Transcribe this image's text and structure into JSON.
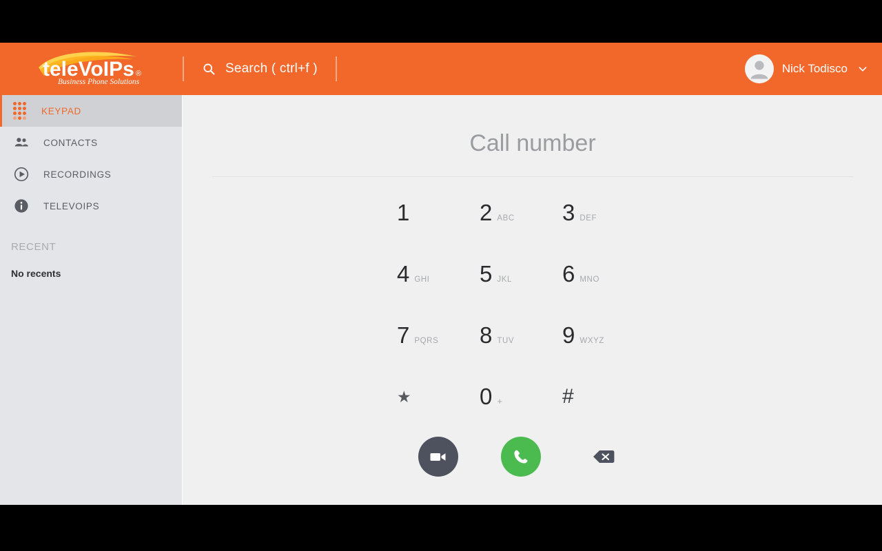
{
  "brand": {
    "logo_text": "teleVoIPs",
    "logo_registered": "®",
    "logo_tagline": "Business Phone Solutions",
    "accent_color": "#f2672a",
    "call_green": "#4cbb4f",
    "video_gray": "#4d525e"
  },
  "topbar": {
    "search_icon": "search-icon",
    "search_label": "Search ( ctrl+f )",
    "user_name": "Nick Todisco",
    "avatar_icon": "user-avatar-icon",
    "chevron_icon": "chevron-down-icon"
  },
  "sidebar": {
    "items": [
      {
        "label": "KEYPAD",
        "icon": "keypad-dots-icon",
        "active": true
      },
      {
        "label": "CONTACTS",
        "icon": "people-icon",
        "active": false
      },
      {
        "label": "RECORDINGS",
        "icon": "play-circle-icon",
        "active": false
      },
      {
        "label": "TELEVOIPS",
        "icon": "info-icon",
        "active": false
      }
    ],
    "recent_heading": "RECENT",
    "no_recents": "No recents"
  },
  "dialer": {
    "number_placeholder": "Call number",
    "number_value": "",
    "keys": [
      {
        "digit": "1",
        "letters": ""
      },
      {
        "digit": "2",
        "letters": "ABC"
      },
      {
        "digit": "3",
        "letters": "DEF"
      },
      {
        "digit": "4",
        "letters": "GHI"
      },
      {
        "digit": "5",
        "letters": "JKL"
      },
      {
        "digit": "6",
        "letters": "MNO"
      },
      {
        "digit": "7",
        "letters": "PQRS"
      },
      {
        "digit": "8",
        "letters": "TUV"
      },
      {
        "digit": "9",
        "letters": "WXYZ"
      },
      {
        "digit": "★",
        "letters": ""
      },
      {
        "digit": "0",
        "letters": "+"
      },
      {
        "digit": "#",
        "letters": ""
      }
    ],
    "actions": {
      "video_icon": "video-camera-icon",
      "call_icon": "phone-handset-icon",
      "backspace_icon": "backspace-icon"
    }
  }
}
